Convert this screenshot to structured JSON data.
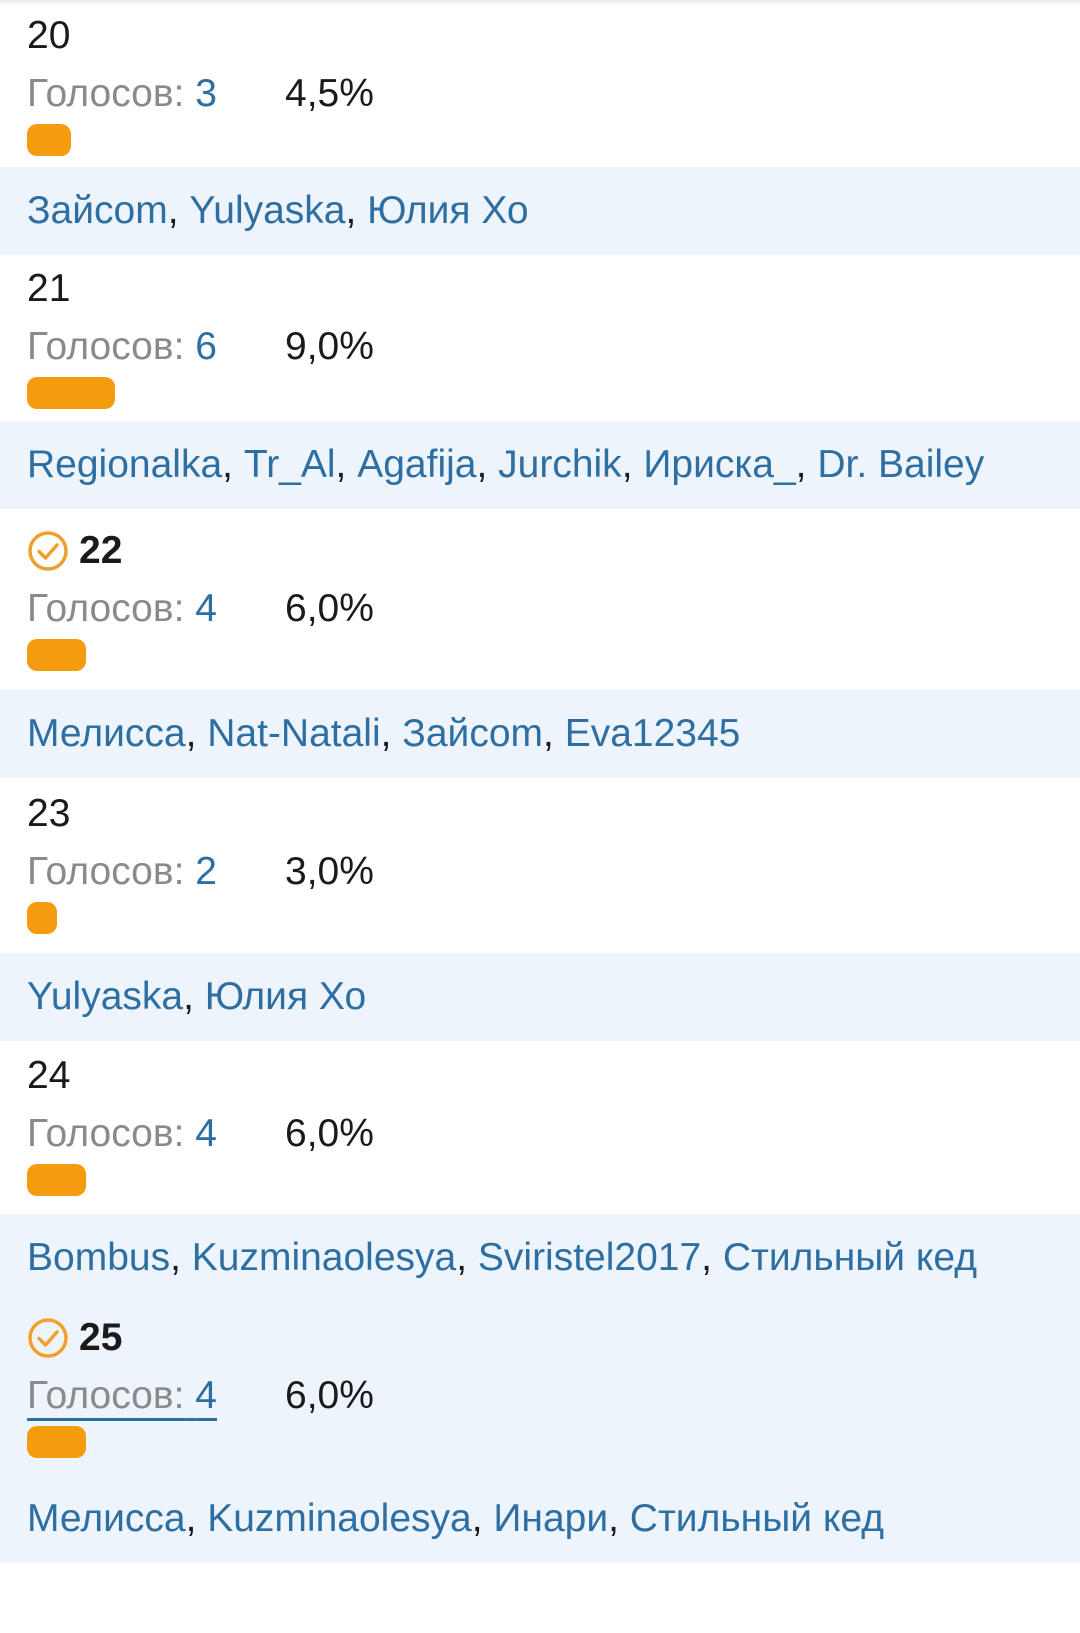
{
  "colors": {
    "accent_bar": "#f59b0e",
    "link": "#2e6fa3",
    "voters_background": "#eef4fb",
    "chosen_check": "#f2a02d"
  },
  "votes_label": "Голосов:",
  "options": [
    {
      "number": "20",
      "votes": "3",
      "percent": "4,5%",
      "bar_fraction": 0.045,
      "chosen": false,
      "voters": [
        "Зайcom",
        "Yulyaska",
        "Юлия Хо"
      ]
    },
    {
      "number": "21",
      "votes": "6",
      "percent": "9,0%",
      "bar_fraction": 0.09,
      "chosen": false,
      "voters": [
        "Regionalka",
        "Tr_Al",
        "Agafija",
        "Jurchik",
        "Ириска_",
        "Dr. Bailey"
      ]
    },
    {
      "number": "22",
      "votes": "4",
      "percent": "6,0%",
      "bar_fraction": 0.06,
      "chosen": true,
      "check_icon": "check-circle-icon",
      "voters": [
        "Мелисса",
        "Nat-Natali",
        "Зайcom",
        "Eva12345"
      ]
    },
    {
      "number": "23",
      "votes": "2",
      "percent": "3,0%",
      "bar_fraction": 0.03,
      "chosen": false,
      "voters": [
        "Yulyaska",
        "Юлия Хо"
      ]
    },
    {
      "number": "24",
      "votes": "4",
      "percent": "6,0%",
      "bar_fraction": 0.06,
      "chosen": false,
      "voters": [
        "Bombus",
        "Kuzminaolesya",
        "Sviristel2017",
        "Стильный кед"
      ]
    },
    {
      "number": "25",
      "votes": "4",
      "percent": "6,0%",
      "bar_fraction": 0.06,
      "chosen": true,
      "check_icon": "check-circle-icon",
      "votes_underlined": true,
      "voters": [
        "Мелисса",
        "Kuzminaolesya",
        "Инари",
        "Стильный кед"
      ]
    }
  ]
}
